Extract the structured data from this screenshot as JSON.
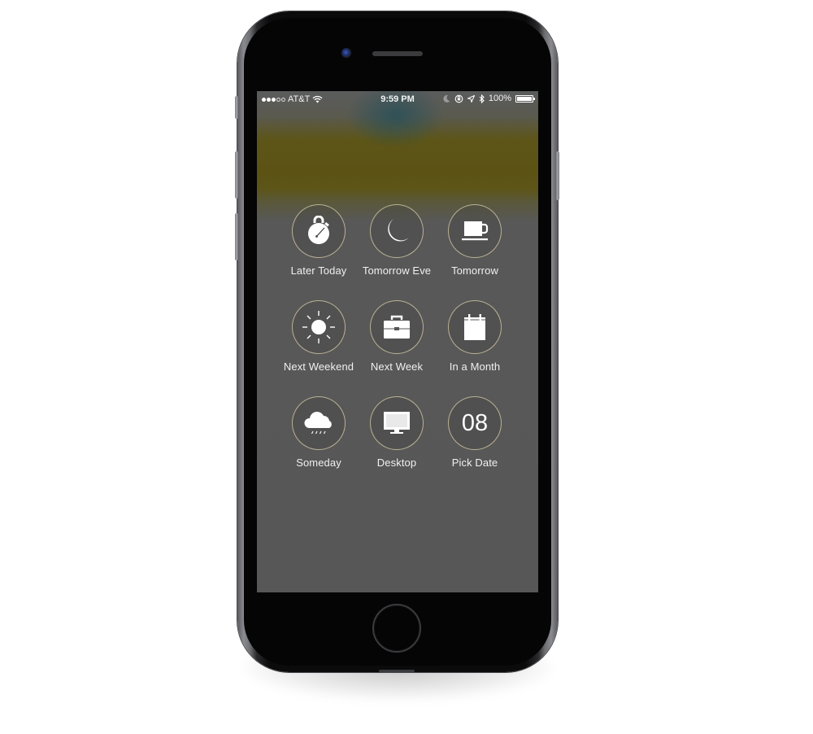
{
  "device": {
    "model_description": "iPhone (space gray)"
  },
  "status_bar": {
    "signal_bars_filled": 3,
    "signal_bars_total": 5,
    "carrier": "AT&T",
    "time": "9:59 PM",
    "battery_percent_label": "100%",
    "battery_level": 1.0,
    "icons": [
      "wifi-icon",
      "moon-icon",
      "rotation-lock-icon",
      "location-icon",
      "bluetooth-icon",
      "battery-icon"
    ]
  },
  "snooze_options": [
    {
      "id": "later-today",
      "label": "Later Today",
      "icon": "stopwatch-icon"
    },
    {
      "id": "tomorrow-eve",
      "label": "Tomorrow Eve",
      "icon": "moon-icon"
    },
    {
      "id": "tomorrow",
      "label": "Tomorrow",
      "icon": "coffee-cup-icon"
    },
    {
      "id": "next-weekend",
      "label": "Next Weekend",
      "icon": "sun-icon"
    },
    {
      "id": "next-week",
      "label": "Next Week",
      "icon": "briefcase-icon"
    },
    {
      "id": "in-a-month",
      "label": "In a Month",
      "icon": "calendar-icon"
    },
    {
      "id": "someday",
      "label": "Someday",
      "icon": "rain-cloud-icon"
    },
    {
      "id": "desktop",
      "label": "Desktop",
      "icon": "monitor-icon"
    },
    {
      "id": "pick-date",
      "label": "Pick Date",
      "icon": "date-number-icon",
      "icon_text": "08"
    }
  ],
  "colors": {
    "screen_background": "#575757",
    "tint_band": "#5c5214",
    "circle_border": "#dcd2aa",
    "icon": "#ffffff",
    "label": "#f0f0f0"
  }
}
